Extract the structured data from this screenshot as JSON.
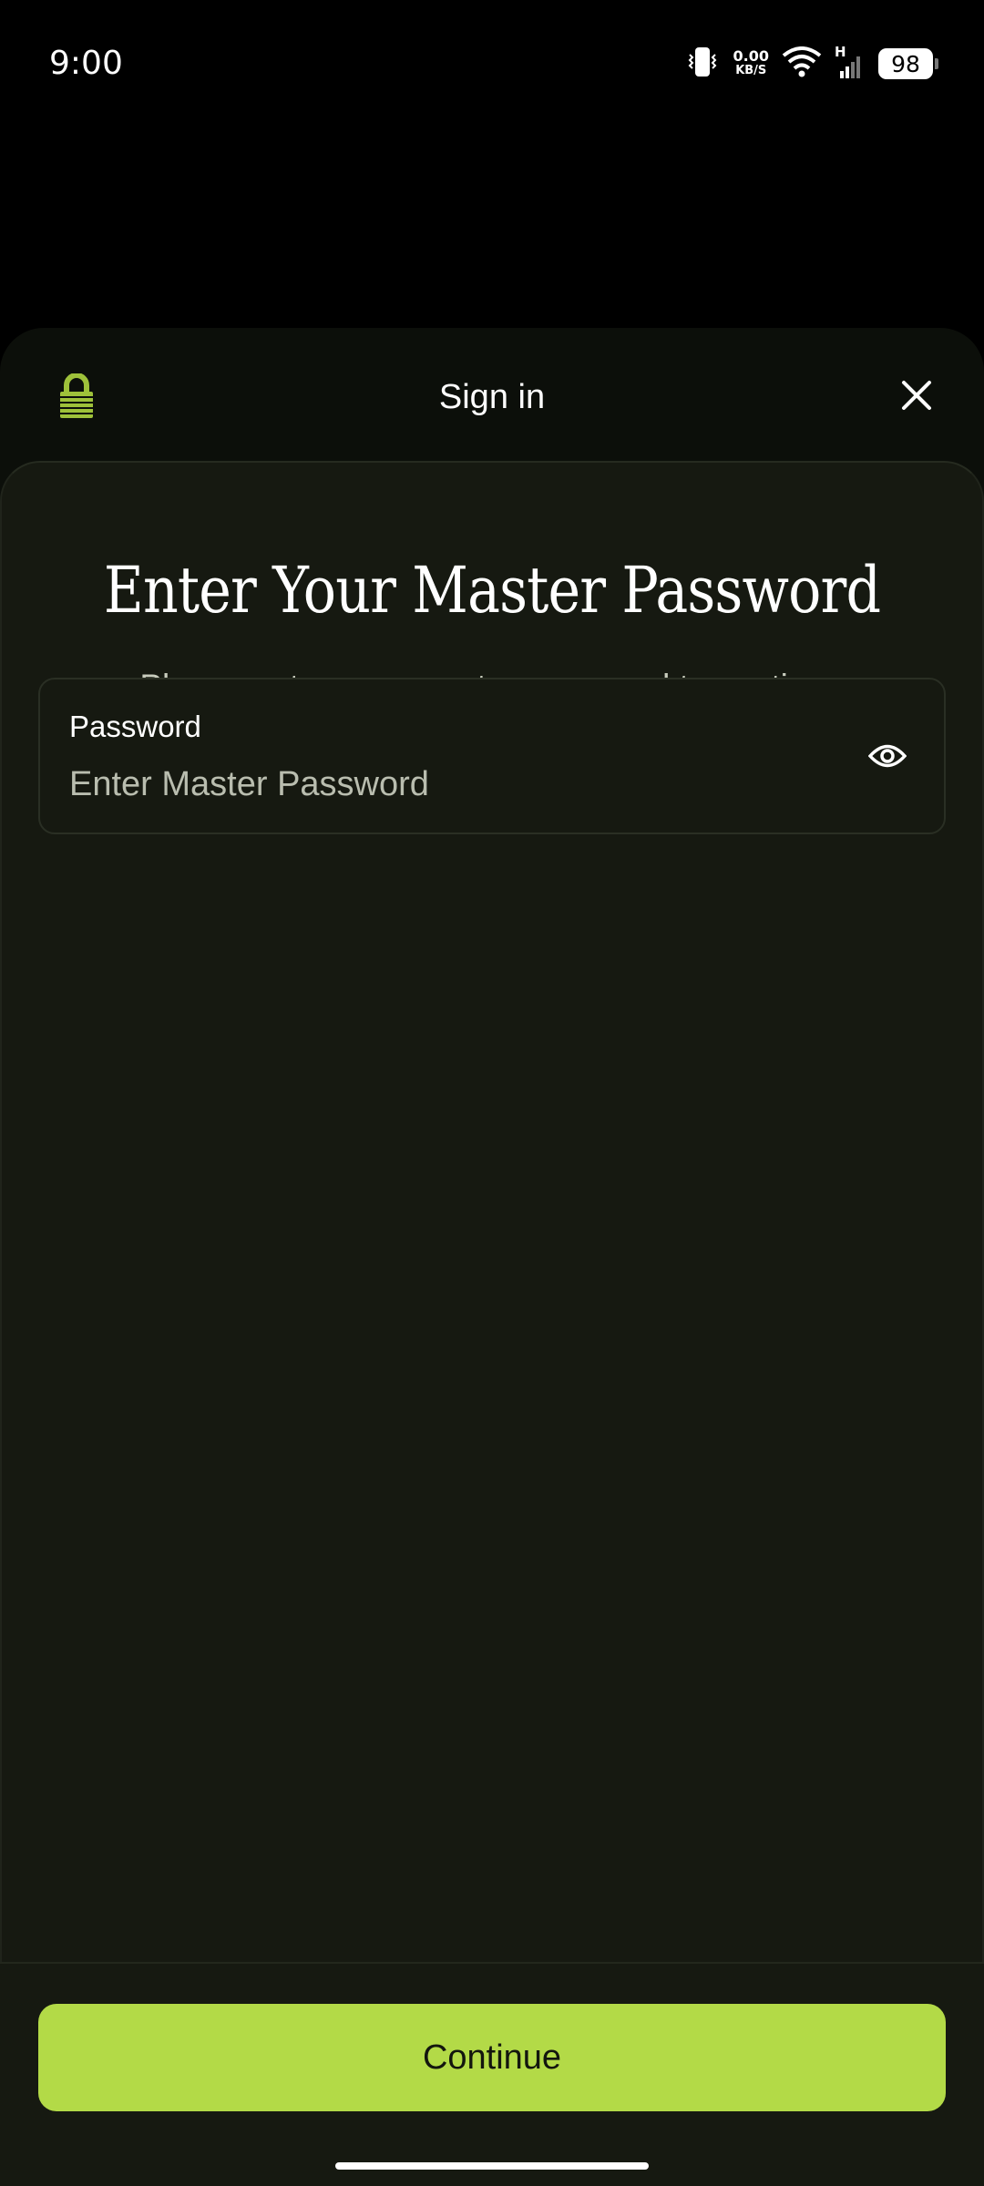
{
  "status_bar": {
    "time": "9:00",
    "net_speed_value": "0.00",
    "net_speed_unit": "KB/S",
    "network_type": "H",
    "battery": "98"
  },
  "header": {
    "title": "Sign in",
    "lock_icon": "lock-icon",
    "close_icon": "close-icon"
  },
  "main": {
    "headline": "Enter Your Master Password",
    "subtitle": "Please enter your master password to continue",
    "password_field": {
      "label": "Password",
      "value": "",
      "placeholder": "Enter Master Password",
      "toggle_icon": "eye-icon"
    }
  },
  "footer": {
    "continue_label": "Continue"
  },
  "colors": {
    "accent": "#b3da47",
    "background": "#161911",
    "header_bg": "#0c0f0a"
  }
}
